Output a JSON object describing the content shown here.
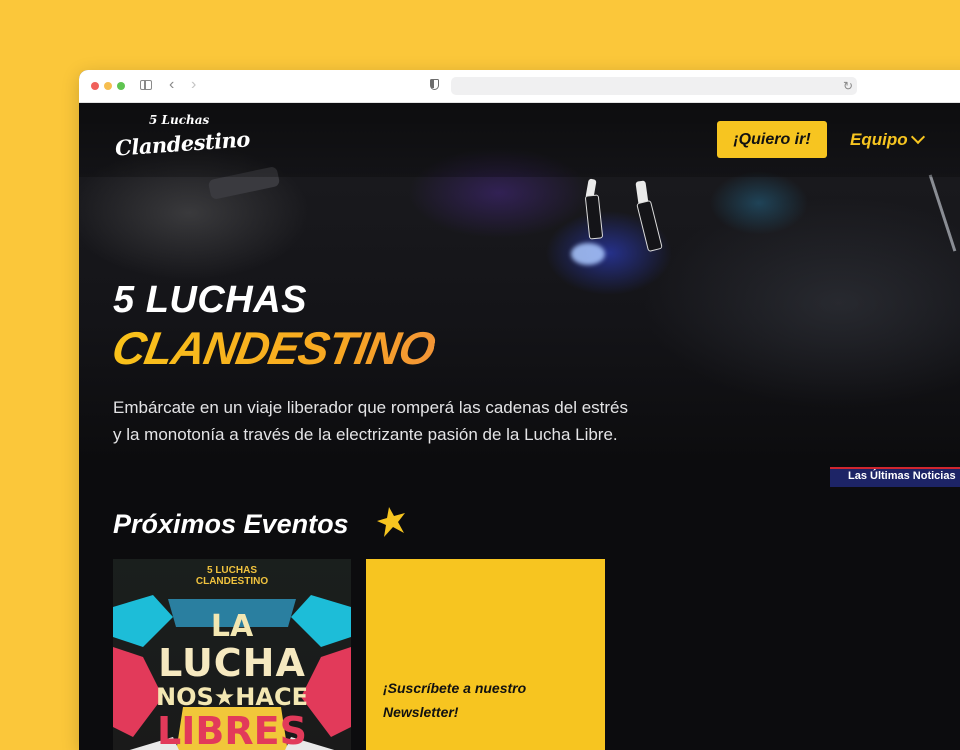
{
  "browser": {
    "url": ""
  },
  "header": {
    "logo_top": "5 Luchas",
    "logo_main": "Clandestino",
    "cta_label": "¡Quiero ir!",
    "team_label": "Equipo"
  },
  "hero": {
    "title_line1": "5 LUCHAS",
    "title_line2": "CLANDESTINO",
    "description": "Embárcate en un viaje liberador que romperá las cadenas del estrés y la monotonía a través de la electrizante pasión de la Lucha Libre."
  },
  "ticker": {
    "label": "Las Últimas Noticias"
  },
  "events": {
    "title": "Próximos Eventos",
    "poster": {
      "top_line1": "5 LUCHAS",
      "top_line2": "CLANDESTINO",
      "line1": "LA",
      "line2": "LUCHA",
      "line3": "NOS★HACE",
      "line4": "LIBRES"
    },
    "newsletter_label": "¡Suscríbete a nuestro Newsletter!"
  },
  "colors": {
    "accent": "#f7c520",
    "background": "#fbc73a",
    "page": "#0c0c0e",
    "ticker": "#1d2466"
  }
}
